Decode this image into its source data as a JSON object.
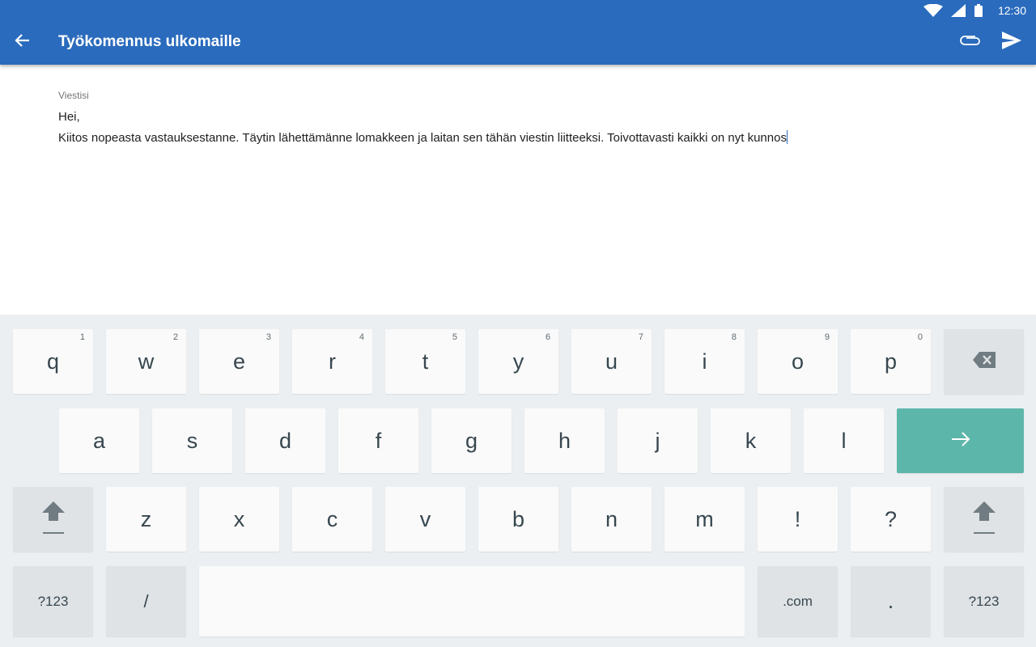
{
  "status_bar": {
    "time": "12:30",
    "wifi_icon": "wifi-icon",
    "signal_icon": "cell-signal-icon",
    "battery_icon": "battery-icon"
  },
  "app_bar": {
    "title": "Työkomennus ulkomaille",
    "back_icon": "arrow-back-icon",
    "attach_icon": "paperclip-icon",
    "send_icon": "send-icon",
    "color": "#2a6bbd"
  },
  "compose": {
    "label": "Viestisi",
    "line1": "Hei,",
    "line2": "Kiitos nopeasta vastauksestanne. Täytin lähettämänne lomakkeen ja laitan sen tähän viestin liitteeksi. Toivottavasti kaikki on nyt kunnos"
  },
  "keyboard": {
    "row1": [
      {
        "ch": "q",
        "hint": "1"
      },
      {
        "ch": "w",
        "hint": "2"
      },
      {
        "ch": "e",
        "hint": "3"
      },
      {
        "ch": "r",
        "hint": "4"
      },
      {
        "ch": "t",
        "hint": "5"
      },
      {
        "ch": "y",
        "hint": "6"
      },
      {
        "ch": "u",
        "hint": "7"
      },
      {
        "ch": "i",
        "hint": "8"
      },
      {
        "ch": "o",
        "hint": "9"
      },
      {
        "ch": "p",
        "hint": "0"
      }
    ],
    "row2": [
      "a",
      "s",
      "d",
      "f",
      "g",
      "h",
      "j",
      "k",
      "l"
    ],
    "row3": [
      "z",
      "x",
      "c",
      "v",
      "b",
      "n",
      "m",
      "!",
      "?"
    ],
    "row4": {
      "symbols_left": "?123",
      "slash": "/",
      "dotcom": ".com",
      "period": ".",
      "symbols_right": "?123"
    },
    "backspace_icon": "backspace-icon",
    "enter_icon": "arrow-right-icon",
    "shift_icon": "shift-icon",
    "enter_color": "#5db6aa"
  }
}
